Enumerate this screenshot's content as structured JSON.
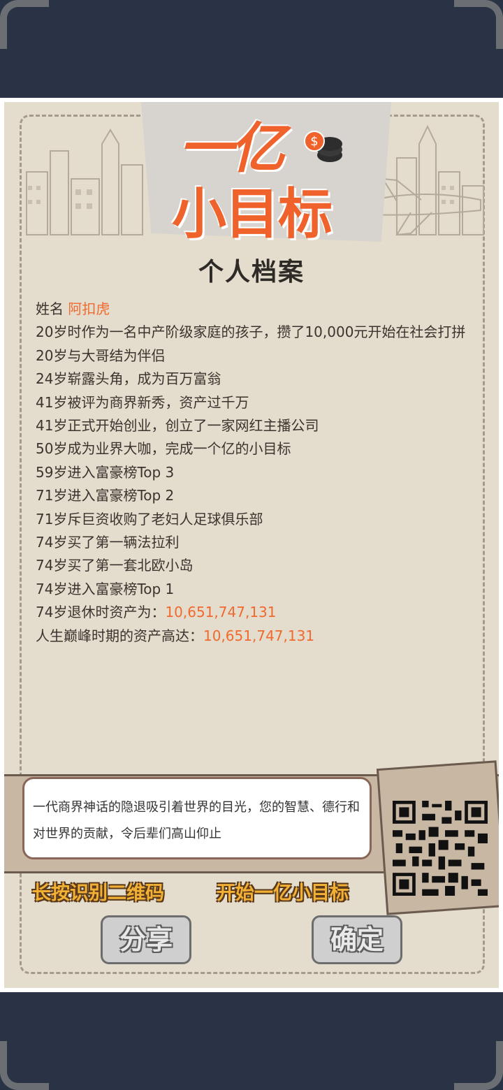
{
  "logo": {
    "line1": "一亿",
    "line2": "小目标"
  },
  "page_title": "个人档案",
  "profile": {
    "name_label": "姓名",
    "name_value": "阿扣虎",
    "events": [
      "20岁时作为一名中产阶级家庭的孩子，攒了10,000元开始在社会打拼",
      "20岁与大哥结为伴侣",
      "24岁崭露头角，成为百万富翁",
      "41岁被评为商界新秀，资产过千万",
      "41岁正式开始创业，创立了一家网红主播公司",
      "50岁成为业界大咖，完成一个亿的小目标",
      "59岁进入富豪榜Top 3",
      "71岁进入富豪榜Top 2",
      "71岁斥巨资收购了老妇人足球俱乐部",
      "74岁买了第一辆法拉利",
      "74岁买了第一套北欧小岛",
      "74岁进入富豪榜Top 1"
    ],
    "retire_label": "74岁退休时资产为：",
    "retire_value": "10,651,747,131",
    "peak_label": "人生巅峰时期的资产高达：",
    "peak_value": "10,651,747,131"
  },
  "quote": "一代商界神话的隐退吸引着世界的目光，您的智慧、德行和对世界的贡献，令后辈们高山仰止",
  "cta_left": "长按识别二维码",
  "cta_right": "开始一亿小目标",
  "buttons": {
    "share": "分享",
    "ok": "确定"
  },
  "colors": {
    "accent": "#f06a2e",
    "paper": "#e4dccd",
    "frame": "#2a3346",
    "cta": "#f2b035"
  }
}
